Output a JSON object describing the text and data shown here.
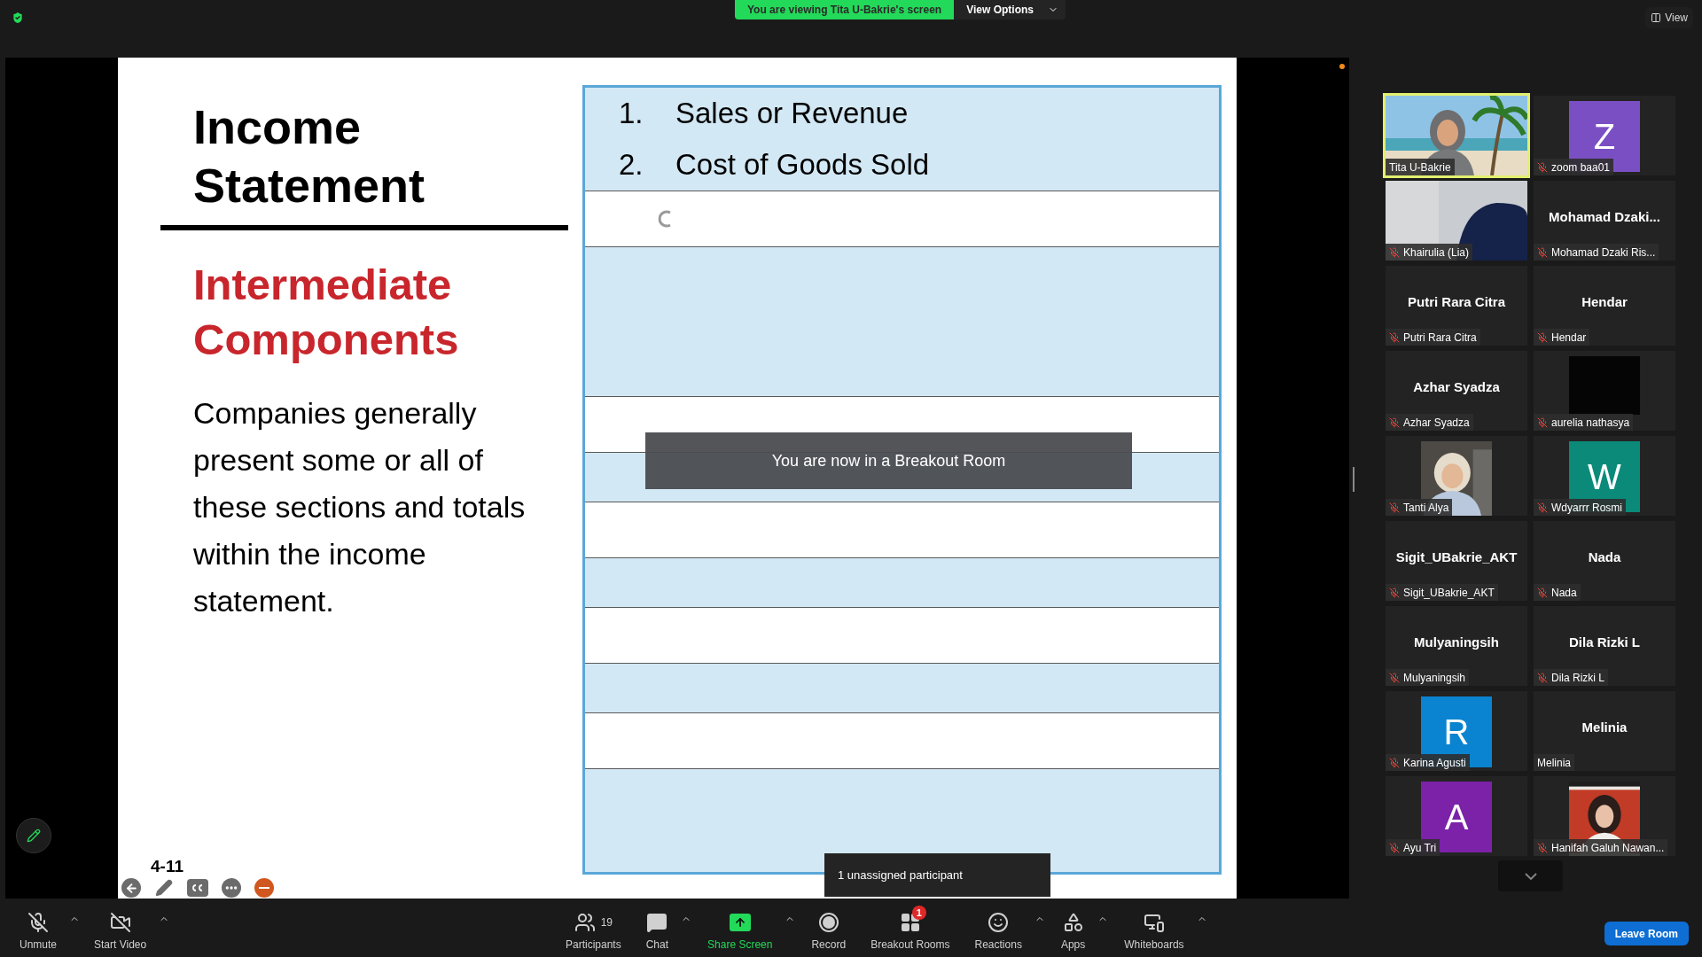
{
  "top_bar": {
    "banner": "You are viewing Tita U-Bakrie's screen",
    "view_options": "View Options",
    "view_button": "View"
  },
  "slide": {
    "title": "Income Statement",
    "subtitle": "Intermediate Components",
    "paragraph": "Companies generally present some or all of these sections and totals within the income statement.",
    "page": "4-11",
    "table_rows": [
      {
        "kind": "item",
        "number": "1.",
        "text": "Sales or Revenue"
      },
      {
        "kind": "item",
        "number": "2.",
        "text": "Cost of Goods Sold"
      },
      {
        "kind": "blank",
        "loading": true
      },
      {
        "kind": "blank",
        "loading": false
      },
      {
        "kind": "blank",
        "loading": false
      },
      {
        "kind": "blank",
        "loading": false
      },
      {
        "kind": "blank",
        "loading": false
      }
    ]
  },
  "breakout_notice": "You are now in a Breakout Room",
  "unassigned_tooltip": "1 unassigned participant",
  "participants": [
    {
      "kind": "video",
      "name": "Tita U-Bakrie",
      "muted": false,
      "speaking": true
    },
    {
      "kind": "avatar",
      "initial": "Z",
      "color": "#7b4fc4",
      "name": "zoom baa01",
      "muted": true,
      "speaking": false
    },
    {
      "kind": "video",
      "name": "Khairulia (Lia)",
      "muted": true,
      "speaking": false
    },
    {
      "kind": "name",
      "display": "Mohamad  Dzaki...",
      "name": "Mohamad Dzaki Ris...",
      "muted": true,
      "speaking": false
    },
    {
      "kind": "name",
      "display": "Putri Rara Citra",
      "name": "Putri Rara Citra",
      "muted": true,
      "speaking": false
    },
    {
      "kind": "name",
      "display": "Hendar",
      "name": "Hendar",
      "muted": true,
      "speaking": false
    },
    {
      "kind": "name",
      "display": "Azhar Syadza",
      "name": "Azhar Syadza",
      "muted": true,
      "speaking": false
    },
    {
      "kind": "blank",
      "name": "aurelia nathasya",
      "muted": true,
      "speaking": false
    },
    {
      "kind": "video",
      "name": "Tanti Alya",
      "muted": true,
      "speaking": false
    },
    {
      "kind": "avatar",
      "initial": "W",
      "color": "#0b8a7a",
      "name": "Wdyarrr Rosmi",
      "muted": true,
      "speaking": false
    },
    {
      "kind": "name",
      "display": "Sigit_UBakrie_AKT",
      "name": "Sigit_UBakrie_AKT",
      "muted": true,
      "speaking": false
    },
    {
      "kind": "name",
      "display": "Nada",
      "name": "Nada",
      "muted": true,
      "speaking": false
    },
    {
      "kind": "name",
      "display": "Mulyaningsih",
      "name": "Mulyaningsih",
      "muted": true,
      "speaking": false
    },
    {
      "kind": "name",
      "display": "Dila Rizki L",
      "name": "Dila Rizki L",
      "muted": true,
      "speaking": false
    },
    {
      "kind": "avatar",
      "initial": "R",
      "color": "#0a84d0",
      "name": "Karina Agusti",
      "muted": true,
      "speaking": false
    },
    {
      "kind": "name",
      "display": "Melinia",
      "name": "Melinia",
      "muted": false,
      "speaking": false
    },
    {
      "kind": "avatar",
      "initial": "A",
      "color": "#7b22a8",
      "name": "Ayu Tri",
      "muted": true,
      "speaking": false
    },
    {
      "kind": "video",
      "name": "Hanifah Galuh Nawan...",
      "muted": true,
      "speaking": false
    }
  ],
  "toolbar": [
    {
      "kind": "mic",
      "label": "Unmute",
      "caret": true
    },
    {
      "kind": "video",
      "label": "Start Video",
      "caret": true
    },
    {
      "kind": "participants",
      "label": "Participants",
      "count": "19",
      "caret": false
    },
    {
      "kind": "chat",
      "label": "Chat",
      "caret": true
    },
    {
      "kind": "share",
      "label": "Share Screen",
      "caret": true
    },
    {
      "kind": "record",
      "label": "Record",
      "caret": false
    },
    {
      "kind": "breakout",
      "label": "Breakout Rooms",
      "badge": "1",
      "caret": false
    },
    {
      "kind": "reactions",
      "label": "Reactions",
      "caret": true
    },
    {
      "kind": "apps",
      "label": "Apps",
      "caret": true
    },
    {
      "kind": "whiteboard",
      "label": "Whiteboards",
      "caret": true
    }
  ],
  "leave_button": "Leave Room"
}
